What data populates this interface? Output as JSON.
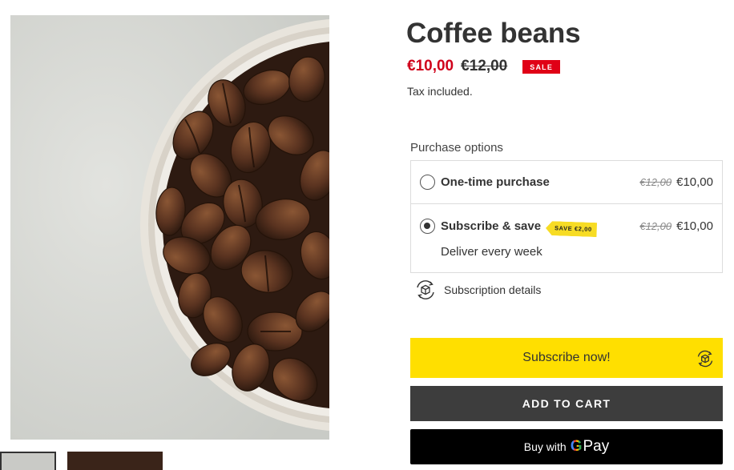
{
  "product": {
    "title": "Coffee beans",
    "sale_price": "€10,00",
    "compare_price": "€12,00",
    "sale_badge": "SALE",
    "tax_note": "Tax included."
  },
  "purchase_options": {
    "label": "Purchase options",
    "options": [
      {
        "label": "One-time purchase",
        "compare_price": "€12,00",
        "price": "€10,00",
        "selected": false
      },
      {
        "label": "Subscribe & save",
        "save_tag": "SAVE €2,00",
        "compare_price": "€12,00",
        "price": "€10,00",
        "delivery": "Deliver every week",
        "selected": true
      }
    ]
  },
  "subscription_details": {
    "label": "Subscription details",
    "icon": "subscription-box-icon"
  },
  "buttons": {
    "subscribe": "Subscribe now!",
    "add_to_cart": "ADD TO CART",
    "gpay_prefix": "Buy with",
    "gpay_g": "G",
    "gpay_pay": "Pay"
  },
  "colors": {
    "sale_red": "#d0021b",
    "subscribe_yellow": "#ffdf00",
    "cart_dark": "#3d3d3d",
    "save_tag_yellow": "#f7dc24"
  }
}
